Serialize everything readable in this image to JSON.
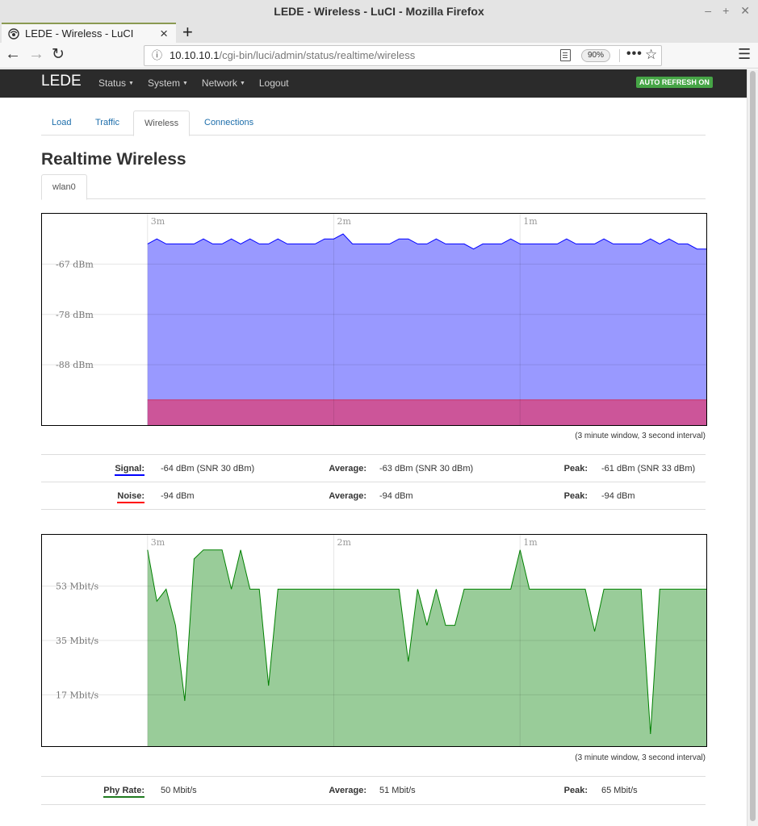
{
  "browser": {
    "window_title": "LEDE - Wireless - LuCI - Mozilla Firefox",
    "tab_title": "LEDE - Wireless - LuCI",
    "url_host": "10.10.10.1",
    "url_path": "/cgi-bin/luci/admin/status/realtime/wireless",
    "zoom": "90%"
  },
  "header": {
    "brand": "LEDE",
    "menu": [
      {
        "label": "Status"
      },
      {
        "label": "System"
      },
      {
        "label": "Network"
      },
      {
        "label": "Logout"
      }
    ],
    "auto_refresh": "AUTO REFRESH ON"
  },
  "tabs": [
    {
      "label": "Load"
    },
    {
      "label": "Traffic"
    },
    {
      "label": "Wireless"
    },
    {
      "label": "Connections"
    }
  ],
  "page_title": "Realtime Wireless",
  "interface_tab": "wlan0",
  "signal_graph": {
    "time_labels": [
      "3m",
      "2m",
      "1m"
    ],
    "y_labels": [
      "-67 dBm",
      "-78 dBm",
      "-88 dBm"
    ],
    "colors": {
      "signal_fill": "#9999ff",
      "signal_line": "#0000ff",
      "noise_fill": "#ff0000"
    },
    "window_note": "(3 minute window, 3 second interval)"
  },
  "signal_stats": {
    "signal_label": "Signal:",
    "signal_value": "-64 dBm (SNR 30 dBm)",
    "signal_average_label": "Average:",
    "signal_average": "-63 dBm (SNR 30 dBm)",
    "signal_peak_label": "Peak:",
    "signal_peak": "-61 dBm (SNR 33 dBm)",
    "noise_label": "Noise:",
    "noise_value": "-94 dBm",
    "noise_average_label": "Average:",
    "noise_average": "-94 dBm",
    "noise_peak_label": "Peak:",
    "noise_peak": "-94 dBm"
  },
  "rate_graph": {
    "time_labels": [
      "3m",
      "2m",
      "1m"
    ],
    "y_labels": [
      "53 Mbit/s",
      "35 Mbit/s",
      "17 Mbit/s"
    ],
    "colors": {
      "rate_fill": "#99cc99",
      "rate_line": "#008000"
    },
    "window_note": "(3 minute window, 3 second interval)"
  },
  "rate_stats": {
    "rate_label": "Phy Rate:",
    "rate_value": "50 Mbit/s",
    "average_label": "Average:",
    "average_value": "51 Mbit/s",
    "peak_label": "Peak:",
    "peak_value": "65 Mbit/s"
  },
  "chart_data": [
    {
      "type": "area",
      "x": [
        180,
        177,
        174,
        171,
        168,
        165,
        162,
        159,
        156,
        153,
        150,
        147,
        144,
        141,
        138,
        135,
        132,
        129,
        126,
        123,
        120,
        117,
        114,
        111,
        108,
        105,
        102,
        99,
        96,
        93,
        90,
        87,
        84,
        81,
        78,
        75,
        72,
        69,
        66,
        63,
        60,
        57,
        54,
        51,
        48,
        45,
        42,
        39,
        36,
        33,
        30,
        27,
        24,
        21,
        18,
        15,
        12,
        9,
        6,
        3
      ],
      "series": [
        {
          "name": "Signal",
          "values": [
            -63,
            -62,
            -63,
            -63,
            -63,
            -63,
            -62,
            -63,
            -63,
            -62,
            -63,
            -62,
            -63,
            -63,
            -62,
            -63,
            -63,
            -63,
            -63,
            -62,
            -62,
            -61,
            -63,
            -63,
            -63,
            -63,
            -63,
            -62,
            -62,
            -63,
            -63,
            -62,
            -63,
            -63,
            -63,
            -64,
            -63,
            -63,
            -63,
            -62,
            -63,
            -63,
            -63,
            -63,
            -63,
            -62,
            -63,
            -63,
            -63,
            -62,
            -63,
            -63,
            -63,
            -63,
            -62,
            -63,
            -62,
            -63,
            -63,
            -64
          ]
        },
        {
          "name": "Noise",
          "values": [
            -94,
            -94,
            -94,
            -94,
            -94,
            -94,
            -94,
            -94,
            -94,
            -94,
            -94,
            -94,
            -94,
            -94,
            -94,
            -94,
            -94,
            -94,
            -94,
            -94,
            -94,
            -94,
            -94,
            -94,
            -94,
            -94,
            -94,
            -94,
            -94,
            -94,
            -94,
            -94,
            -94,
            -94,
            -94,
            -94,
            -94,
            -94,
            -94,
            -94,
            -94,
            -94,
            -94,
            -94,
            -94,
            -94,
            -94,
            -94,
            -94,
            -94,
            -94,
            -94,
            -94,
            -94,
            -94,
            -94,
            -94,
            -94,
            -94,
            -94
          ]
        }
      ],
      "xlabel": "",
      "ylabel": "",
      "tick_labels_x": [
        "3m",
        "2m",
        "1m"
      ],
      "tick_labels_y": [
        "-67 dBm",
        "-78 dBm",
        "-88 dBm"
      ],
      "ylim": [
        -99,
        -57
      ],
      "grid": true
    },
    {
      "type": "area",
      "x": [
        180,
        177,
        174,
        171,
        168,
        165,
        162,
        159,
        156,
        153,
        150,
        147,
        144,
        141,
        138,
        135,
        132,
        129,
        126,
        123,
        120,
        117,
        114,
        111,
        108,
        105,
        102,
        99,
        96,
        93,
        90,
        87,
        84,
        81,
        78,
        75,
        72,
        69,
        66,
        63,
        60,
        57,
        54,
        51,
        48,
        45,
        42,
        39,
        36,
        33,
        30,
        27,
        24,
        21,
        18,
        15,
        12,
        9,
        6,
        3,
        0
      ],
      "series": [
        {
          "name": "Phy Rate",
          "values": [
            65,
            48,
            52,
            40,
            15,
            62,
            65,
            65,
            65,
            52,
            65,
            52,
            52,
            20,
            52,
            52,
            52,
            52,
            52,
            52,
            52,
            52,
            52,
            52,
            52,
            52,
            52,
            52,
            28,
            52,
            40,
            52,
            40,
            40,
            52,
            52,
            52,
            52,
            52,
            52,
            65,
            52,
            52,
            52,
            52,
            52,
            52,
            52,
            38,
            52,
            52,
            52,
            52,
            52,
            4,
            52,
            52,
            52,
            52,
            52,
            52
          ]
        }
      ],
      "xlabel": "",
      "ylabel": "",
      "tick_labels_x": [
        "3m",
        "2m",
        "1m"
      ],
      "tick_labels_y": [
        "53 Mbit/s",
        "35 Mbit/s",
        "17 Mbit/s"
      ],
      "ylim": [
        0,
        70
      ],
      "grid": true
    }
  ]
}
